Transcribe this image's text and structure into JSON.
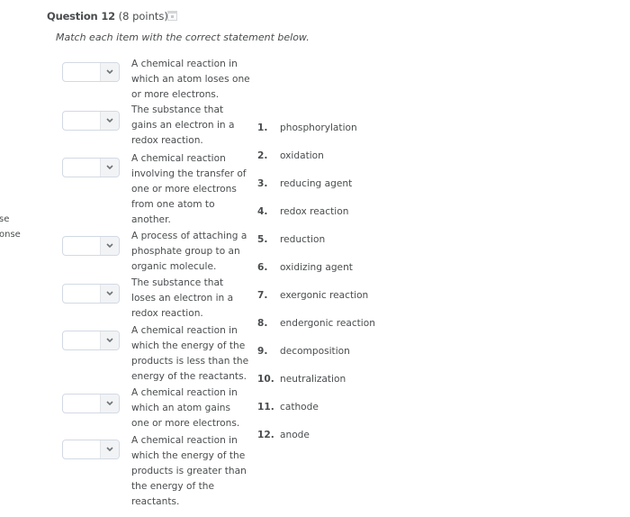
{
  "sidebar_fragments": [
    "se",
    "onse"
  ],
  "question": {
    "title": "Question 12",
    "points": "(8 points)",
    "flag_icon": "bookmark-flag-icon",
    "instructions": "Match each item with the correct statement below."
  },
  "statements": [
    {
      "selected": "",
      "text": "A chemical reaction in which an atom loses one or more electrons."
    },
    {
      "selected": "",
      "text": "The substance that gains an electron in a redox reaction."
    },
    {
      "selected": "",
      "text": "A chemical reaction involving the transfer of one or more electrons from one atom to another."
    },
    {
      "selected": "",
      "text": "A process of attaching a phosphate group to an organic molecule."
    },
    {
      "selected": "",
      "text": "The substance that loses an electron in a redox reaction."
    },
    {
      "selected": "",
      "text": "A chemical reaction in which the energy of the products is less than the energy of the reactants."
    },
    {
      "selected": "",
      "text": "A chemical reaction in which an atom gains one or more electrons."
    },
    {
      "selected": "",
      "text": "A chemical reaction in which the energy of the products is greater than the energy of the reactants."
    }
  ],
  "choices": [
    {
      "num": "1.",
      "label": "phosphorylation"
    },
    {
      "num": "2.",
      "label": "oxidation"
    },
    {
      "num": "3.",
      "label": "reducing agent"
    },
    {
      "num": "4.",
      "label": "redox reaction"
    },
    {
      "num": "5.",
      "label": "reduction"
    },
    {
      "num": "6.",
      "label": "oxidizing agent"
    },
    {
      "num": "7.",
      "label": "exergonic reaction"
    },
    {
      "num": "8.",
      "label": "endergonic reaction"
    },
    {
      "num": "9.",
      "label": "decomposition"
    },
    {
      "num": "10.",
      "label": "neutralization"
    },
    {
      "num": "11.",
      "label": "cathode"
    },
    {
      "num": "12.",
      "label": "anode"
    }
  ]
}
